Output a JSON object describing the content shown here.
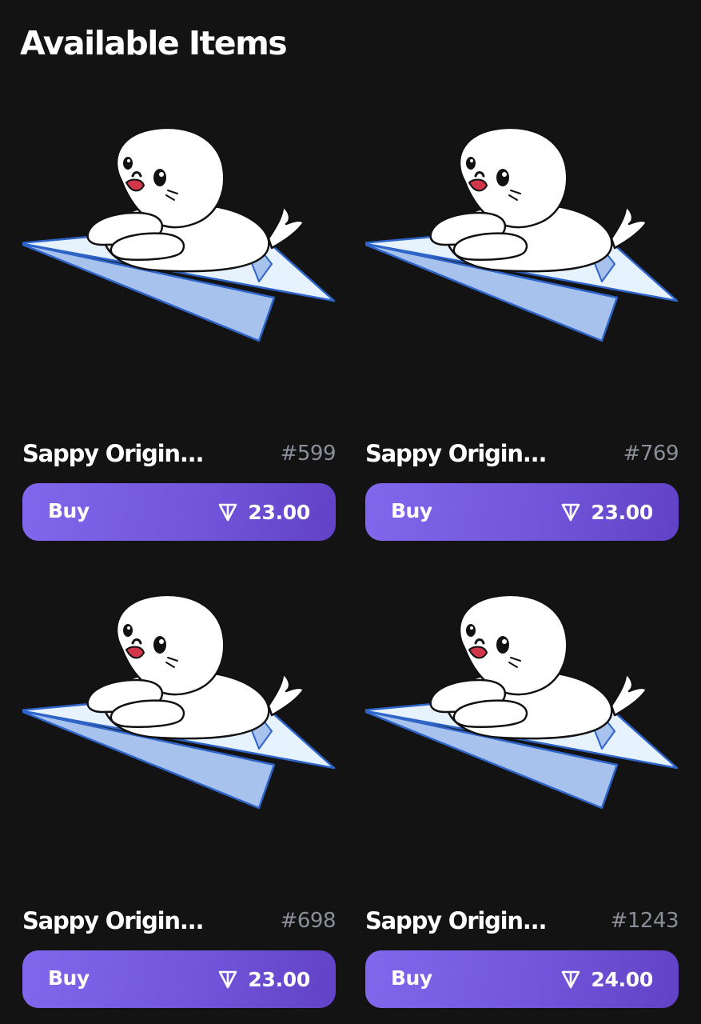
{
  "header": {
    "title": "Available Items"
  },
  "items": [
    {
      "name": "Sappy Origin...",
      "number": "#599",
      "buy_label": "Buy",
      "price": "23.00",
      "icon": "ton-diamond-icon"
    },
    {
      "name": "Sappy Origin...",
      "number": "#769",
      "buy_label": "Buy",
      "price": "23.00",
      "icon": "ton-diamond-icon"
    },
    {
      "name": "Sappy Origin...",
      "number": "#698",
      "buy_label": "Buy",
      "price": "23.00",
      "icon": "ton-diamond-icon"
    },
    {
      "name": "Sappy Origin...",
      "number": "#1243",
      "buy_label": "Buy",
      "price": "24.00",
      "icon": "ton-diamond-icon"
    }
  ],
  "colors": {
    "background": "#131313",
    "button_gradient_start": "#8067ec",
    "button_gradient_end": "#6242c6",
    "number_text": "#8b8f99"
  }
}
